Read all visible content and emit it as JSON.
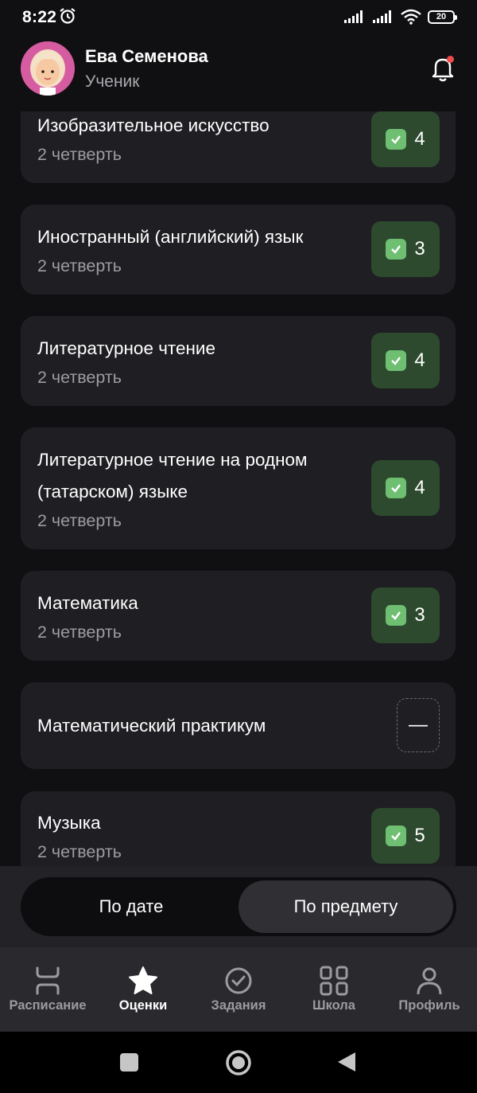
{
  "status": {
    "time": "8:22",
    "battery": "20"
  },
  "user": {
    "name": "Ева Семенова",
    "role": "Ученик"
  },
  "subjects": [
    {
      "title": "Изобразительное искусство",
      "sub": "2 четверть",
      "grade": "4"
    },
    {
      "title": "Иностранный (английский) язык",
      "sub": "2 четверть",
      "grade": "3"
    },
    {
      "title": "Литературное чтение",
      "sub": "2 четверть",
      "grade": "4"
    },
    {
      "title": "Литературное чтение на родном (татарском) языке",
      "sub": "2 четверть",
      "grade": "4"
    },
    {
      "title": "Математика",
      "sub": "2 четверть",
      "grade": "3"
    },
    {
      "title": "Математический практикум",
      "sub": "",
      "grade": "—"
    },
    {
      "title": "Музыка",
      "sub": "2 четверть",
      "grade": "5"
    }
  ],
  "toggle": {
    "by_date": "По дате",
    "by_subject": "По предмету"
  },
  "nav": [
    {
      "label": "Расписание",
      "icon": "schedule-icon"
    },
    {
      "label": "Оценки",
      "icon": "star-icon"
    },
    {
      "label": "Задания",
      "icon": "check-circle-icon"
    },
    {
      "label": "Школа",
      "icon": "grid-icon"
    },
    {
      "label": "Профиль",
      "icon": "user-icon"
    }
  ],
  "colors": {
    "background": "#101012",
    "card": "#1f1f23",
    "grade_badge": "#2d4a2e",
    "check": "#6fbf73",
    "notification_dot": "#ef4b4b"
  }
}
